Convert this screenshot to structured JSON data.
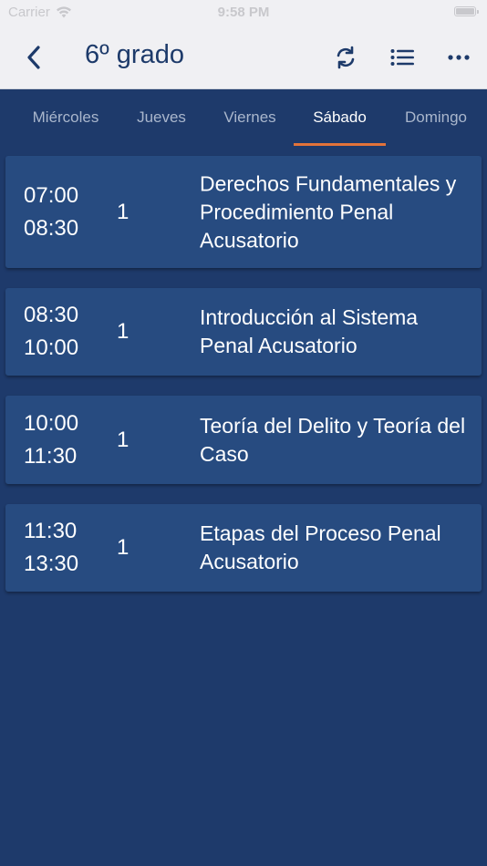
{
  "status_bar": {
    "carrier": "Carrier",
    "time": "9:58 PM"
  },
  "nav": {
    "title": "6º grado",
    "back_icon": "chevron-left-icon",
    "actions": [
      "refresh-icon",
      "list-icon",
      "more-icon"
    ]
  },
  "tabs": [
    {
      "label": "Miércoles"
    },
    {
      "label": "Jueves"
    },
    {
      "label": "Viernes"
    },
    {
      "label": "Sábado",
      "selected": true
    },
    {
      "label": "Domingo"
    }
  ],
  "schedule": [
    {
      "start": "07:00",
      "end": "08:30",
      "count": "1",
      "subject": "Derechos Fundamentales y Procedimiento Penal Acusatorio"
    },
    {
      "start": "08:30",
      "end": "10:00",
      "count": "1",
      "subject": "Introducción al Sistema Penal Acusatorio"
    },
    {
      "start": "10:00",
      "end": "11:30",
      "count": "1",
      "subject": "Teoría del Delito y Teoría del Caso"
    },
    {
      "start": "11:30",
      "end": "13:30",
      "count": "1",
      "subject": "Etapas del Proceso Penal Acusatorio"
    }
  ],
  "colors": {
    "background": "#1e3a6b",
    "card": "#274b80",
    "accent": "#e2733a",
    "nav_tint": "#1d3a6a"
  }
}
